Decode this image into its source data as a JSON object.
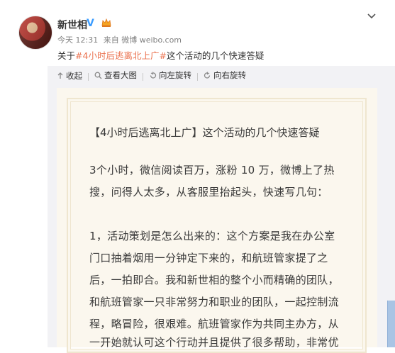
{
  "user": {
    "name": "新世相",
    "verified": "V"
  },
  "meta": {
    "time": "今天 12:31",
    "source": "来自 微博 weibo.com"
  },
  "post": {
    "prefix": "关于",
    "hashtag": "#4小时后逃离北上广#",
    "suffix": "这个活动的几个快速答疑"
  },
  "toolbar": {
    "collapse": "收起",
    "view_large": "查看大图",
    "rotate_left": "向左旋转",
    "rotate_right": "向右旋转"
  },
  "document": {
    "title": "【4小时后逃离北上广】这个活动的几个快速答疑",
    "lines": [
      "3个小时，微信阅读百万，涨粉 10 万，微博上了热",
      "搜，问得人太多，从客服里抬起头，快速写几句：",
      "",
      "1，活动策划是怎么出来的：这个方案是我在办公室",
      "门口抽着烟用一分钟定下来的，和航班管家提了之",
      "后，一拍即合。我和新世相的整个小而精确的团队，",
      "和航班管家一只非常努力和职业的团队，一起控制流",
      "程，略冒险，很艰难。航班管家作为共同主办方，从",
      "一开始就认可这个行动并且提供了很多帮助，非常优"
    ]
  },
  "colors": {
    "hashtag": "#eb7350",
    "verified": "#3b9cff",
    "paper": "#fbf7ee"
  }
}
